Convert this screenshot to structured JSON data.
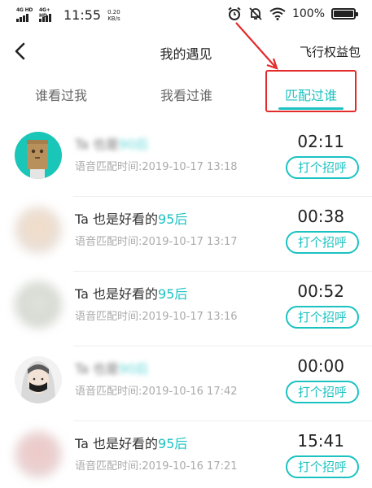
{
  "statusbar": {
    "net1": "4G HD",
    "net2": "4G+ HD",
    "time": "11:55",
    "speed_value": "0.20",
    "speed_unit": "KB/s",
    "battery": "100%"
  },
  "header": {
    "title": "我的遇见",
    "right_link": "飞行权益包"
  },
  "tabs": [
    {
      "label": "谁看过我",
      "active": false
    },
    {
      "label": "我看过谁",
      "active": false
    },
    {
      "label": "匹配过谁",
      "active": true
    }
  ],
  "colors": {
    "accent": "#1cc2c2",
    "highlight": "#e32b2b"
  },
  "rows": [
    {
      "name_prefix": "Ta 也是",
      "name_accent": "90后",
      "name_blurred": true,
      "match_time": "语音匹配时间:2019-10-17 13:18",
      "duration": "02:11",
      "button": "打个招呼",
      "avatar": "paper-bag-avatar"
    },
    {
      "name_prefix": "Ta 也是好看的",
      "name_accent": "95后",
      "name_blurred": false,
      "match_time": "语音匹配时间:2019-10-17 13:17",
      "duration": "00:38",
      "button": "打个招呼",
      "avatar": "blurred-avatar"
    },
    {
      "name_prefix": "Ta 也是好看的",
      "name_accent": "95后",
      "name_blurred": false,
      "match_time": "语音匹配时间:2019-10-17 13:16",
      "duration": "00:52",
      "button": "打个招呼",
      "avatar": "blurred-avatar"
    },
    {
      "name_prefix": "Ta 也是",
      "name_accent": "90后",
      "name_blurred": true,
      "match_time": "语音匹配时间:2019-10-16 17:42",
      "duration": "00:00",
      "button": "打个招呼",
      "avatar": "masked-person-avatar"
    },
    {
      "name_prefix": "Ta 也是好看的",
      "name_accent": "95后",
      "name_blurred": false,
      "match_time": "语音匹配时间:2019-10-16 17:21",
      "duration": "15:41",
      "button": "打个招呼",
      "avatar": "blurred-avatar"
    }
  ]
}
